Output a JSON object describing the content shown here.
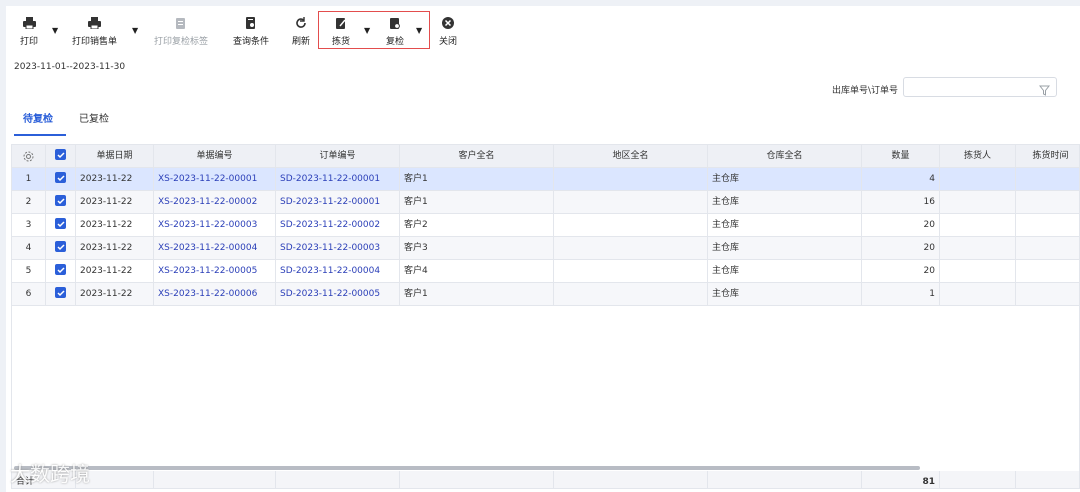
{
  "toolbar": {
    "print": "打印",
    "print_sales": "打印销售单",
    "print_recheck_label": "打印复检标签",
    "query_conditions": "查询条件",
    "refresh": "刷新",
    "picking": "拣货",
    "recheck": "复检",
    "close": "关闭"
  },
  "date_range": "2023-11-01--2023-11-30",
  "filter": {
    "label": "出库单号\\订单号",
    "placeholder": ""
  },
  "tabs": [
    {
      "label": "待复检",
      "active": true
    },
    {
      "label": "已复检",
      "active": false
    }
  ],
  "table": {
    "columns": [
      "单据日期",
      "单据编号",
      "订单编号",
      "客户全名",
      "地区全名",
      "仓库全名",
      "数量",
      "拣货人",
      "拣货时间"
    ],
    "rows": [
      {
        "idx": "1",
        "date": "2023-11-22",
        "doc": "XS-2023-11-22-00001",
        "order": "SD-2023-11-22-00001",
        "customer": "客户1",
        "region": "",
        "warehouse": "主仓库",
        "qty": "4",
        "picker": "",
        "pick_time": ""
      },
      {
        "idx": "2",
        "date": "2023-11-22",
        "doc": "XS-2023-11-22-00002",
        "order": "SD-2023-11-22-00001",
        "customer": "客户1",
        "region": "",
        "warehouse": "主仓库",
        "qty": "16",
        "picker": "",
        "pick_time": ""
      },
      {
        "idx": "3",
        "date": "2023-11-22",
        "doc": "XS-2023-11-22-00003",
        "order": "SD-2023-11-22-00002",
        "customer": "客户2",
        "region": "",
        "warehouse": "主仓库",
        "qty": "20",
        "picker": "",
        "pick_time": ""
      },
      {
        "idx": "4",
        "date": "2023-11-22",
        "doc": "XS-2023-11-22-00004",
        "order": "SD-2023-11-22-00003",
        "customer": "客户3",
        "region": "",
        "warehouse": "主仓库",
        "qty": "20",
        "picker": "",
        "pick_time": ""
      },
      {
        "idx": "5",
        "date": "2023-11-22",
        "doc": "XS-2023-11-22-00005",
        "order": "SD-2023-11-22-00004",
        "customer": "客户4",
        "region": "",
        "warehouse": "主仓库",
        "qty": "20",
        "picker": "",
        "pick_time": ""
      },
      {
        "idx": "6",
        "date": "2023-11-22",
        "doc": "XS-2023-11-22-00006",
        "order": "SD-2023-11-22-00005",
        "customer": "客户1",
        "region": "",
        "warehouse": "主仓库",
        "qty": "1",
        "picker": "",
        "pick_time": ""
      }
    ],
    "footer_label": "合计",
    "footer_qty": "81"
  },
  "watermark": "大数跨境",
  "colors": {
    "accent": "#2b5fd9",
    "highlight_box": "#e34d4d",
    "link": "#2b3fb8"
  }
}
